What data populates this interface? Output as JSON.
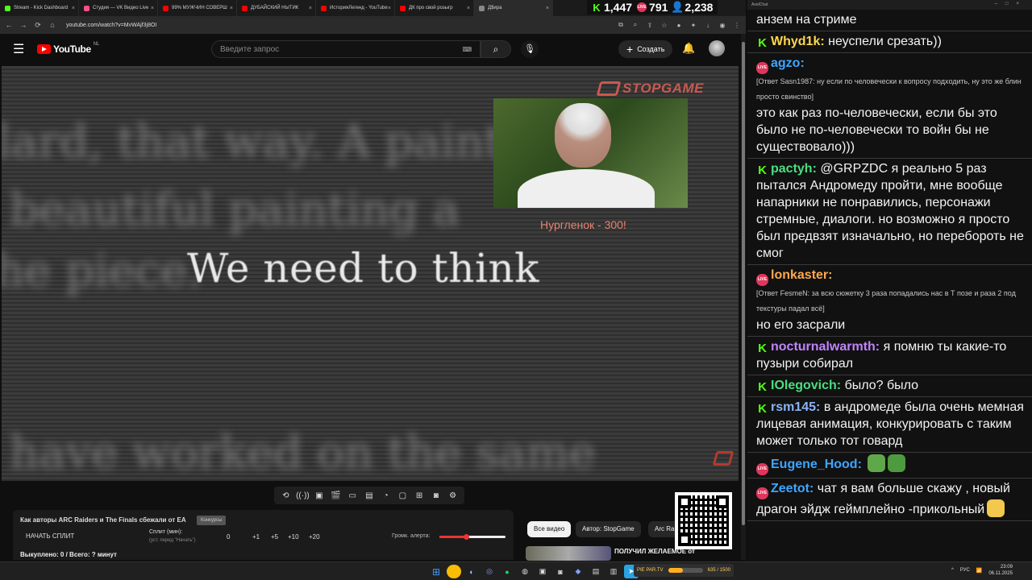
{
  "browser": {
    "tabs": [
      {
        "label": "Stream - Kick Dashboard",
        "color": "#53fc18"
      },
      {
        "label": "Студия — VK Видео Live",
        "color": "#ff4f8b"
      },
      {
        "label": "99% МУЖЧИН СОВЕРШ",
        "color": "#ff0000"
      },
      {
        "label": "ДУБАЙСКИЙ НЫТИК",
        "color": "#ff0000"
      },
      {
        "label": "ИсторияЛегенд - YouTube",
        "color": "#ff0000"
      },
      {
        "label": "ДК про свой розыгр",
        "color": "#ff0000"
      },
      {
        "label": "Д$ира",
        "color": "#888888"
      }
    ],
    "url": "youtube.com/watch?v=MvWAjf3j8OI"
  },
  "stream_stats": {
    "kick_viewers": "1,447",
    "vk_viewers": "791",
    "total_viewers": "2,238"
  },
  "youtube": {
    "logo_text": "YouTube",
    "country": "NL",
    "search_placeholder": "Введите запрос",
    "create_label": "Создать"
  },
  "video": {
    "blur_lines": [
      "lard, that way. A painter",
      "beautiful painting a",
      "he piece.",
      "have worked on the same"
    ],
    "subtitle": "We need to think",
    "watermark": "STOPGAME",
    "cam_caption": "Нургленок - 300!"
  },
  "split_panel": {
    "title": "Как авторы ARC Raiders и The Finals сбежали от EA",
    "tag": "Конкурсы",
    "start_button": "НАЧАТЬ СПЛИТ",
    "split_label": "Сплит (мин):",
    "split_hint": "(уст. перед \"Начать\")",
    "split_value": "0",
    "increments": [
      "+1",
      "+5",
      "+10",
      "+20"
    ],
    "volume_label": "Громк. алерта:",
    "volume_level": 0.4,
    "bought_text": "Выкуплено: 0 / Всего: ? минут"
  },
  "youtube_sidebar": {
    "chips": [
      "Все видео",
      "Автор: StopGame",
      "Arc Ra"
    ],
    "rec_title": "ПОЛУЧИЛ ЖЕЛАЕМОЕ от"
  },
  "chat": {
    "window_title": "AxelChat",
    "messages": [
      {
        "platform": "",
        "user": "",
        "reply": "",
        "text": "анзем на стриме",
        "color": "#ffffff"
      },
      {
        "platform": "kick",
        "user": "Whyd1k:",
        "reply": "",
        "text": "неуспели срезать))",
        "color": "#ffd64a"
      },
      {
        "platform": "live",
        "user": "agzo:",
        "reply": "[Ответ Sasn1987: ну если по человечески к вопросу подходить, ну это же блин просто свинство]",
        "text": "это как раз по-человечески, если бы это было не по-человечески то войн бы не существовало)))",
        "color": "#3ea6ff"
      },
      {
        "platform": "kick",
        "user": "pactyh:",
        "reply": "",
        "text": "@GRPZDC я реально 5 раз пытался Андромеду пройти, мне вообще напарники не понравились, персонажи стремные, диалоги. но возможно я просто был предвзят изначально, но перебороть не смог",
        "color": "#4ade80"
      },
      {
        "platform": "live",
        "user": "lonkaster:",
        "reply": "[Ответ FesmeN: за всю сюжетку 3 раза попадались нас в Т позе и раза 2 под текстуры падал всё]",
        "text": "но его засрали",
        "color": "#ffa94d"
      },
      {
        "platform": "kick",
        "user": "nocturnalwarmth:",
        "reply": "",
        "text": "я помню ты какие-то пузыри собирал",
        "color": "#c084fc"
      },
      {
        "platform": "kick",
        "user": "IOlegovich:",
        "reply": "",
        "text": "было? было",
        "color": "#4ade80"
      },
      {
        "platform": "kick",
        "user": "rsm145:",
        "reply": "",
        "text": "в андромеде была очень мемная лицевая анимация, конкурировать с таким может только тот говард",
        "color": "#8ab4f8"
      },
      {
        "platform": "live",
        "user": "Eugene_Hood:",
        "reply": "",
        "text": "",
        "color": "#3ea6ff",
        "emotes": 2
      },
      {
        "platform": "live",
        "user": "Zeetot:",
        "reply": "",
        "text": "чат я вам больше скажу , новый драгон эйдж геймплейно -прикольный",
        "color": "#3ea6ff",
        "emotes": 1
      }
    ]
  },
  "taskbar": {
    "widget_label": "PIE PAR.TV",
    "widget_value": "635 / 1500",
    "widget_fraction": 0.42,
    "lang": "РУС",
    "time": "23:09",
    "date": "06.11.2025"
  }
}
